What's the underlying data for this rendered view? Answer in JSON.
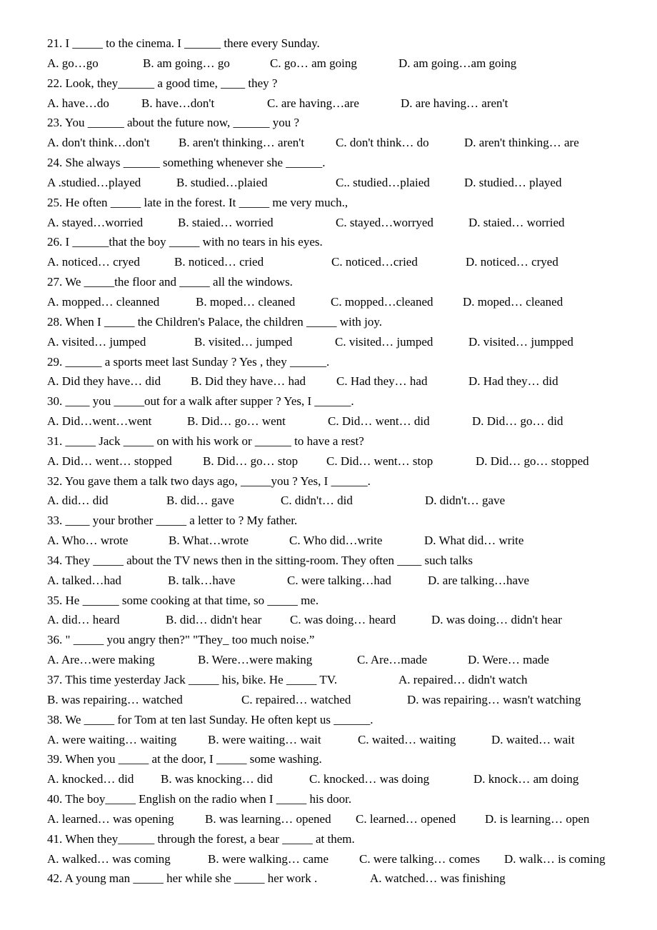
{
  "document": {
    "questions": [
      {
        "stem": "21. I _____ to the cinema. I ______ there every Sunday.",
        "options": [
          "A. go…go",
          "B. am going… go",
          "C. go… am going",
          "D. am going…am going"
        ]
      },
      {
        "stem": "22. Look, they______ a good time, ____ they ?",
        "options": [
          "A. have…do",
          "B. have…don't",
          "C. are having…are",
          "D. are having… aren't"
        ]
      },
      {
        "stem": "23. You ______ about the future now, ______ you ?",
        "options": [
          "A. don't think…don't",
          "B. aren't thinking… aren't",
          "C. don't think… do",
          "D. aren't thinking… are"
        ]
      },
      {
        "stem": "24. She always ______ something whenever she ______.",
        "options": [
          "A .studied…played",
          "B. studied…plaied",
          "C.. studied…plaied",
          "D. studied… played"
        ]
      },
      {
        "stem": "25. He often _____ late in the forest. It _____ me very much.,",
        "options": [
          "A. stayed…worried",
          "B. staied… worried",
          "C. stayed…worryed",
          "D. staied… worried"
        ]
      },
      {
        "stem": "26. I ______that the boy _____ with no tears in his eyes.",
        "options": [
          "A. noticed… cryed",
          "B. noticed… cried",
          "C. noticed…cried",
          "D. noticed… cryed"
        ]
      },
      {
        "stem": "27. We _____the floor and _____ all the windows.",
        "options": [
          "A. mopped… cleanned",
          "B. moped… cleaned",
          "C. mopped…cleaned",
          "D. moped… cleaned"
        ]
      },
      {
        "stem": "28. When I _____ the Children's Palace, the children _____ with joy.",
        "options": [
          "A. visited… jumped",
          "B. visited… jumped",
          "C. visited… jumped",
          "D. visited… jumpped"
        ]
      },
      {
        "stem": "29. ______ a sports meet last Sunday ? Yes , they ______.",
        "options": [
          "A. Did they have… did",
          "B. Did they have… had",
          "C. Had they… had",
          "D. Had they… did"
        ]
      },
      {
        "stem": "30. ____ you _____out for a walk after supper ? Yes, I ______.",
        "options": [
          "A. Did…went…went",
          "B. Did… go… went",
          "C. Did… went… did",
          "D. Did… go… did"
        ]
      },
      {
        "stem": "31. _____ Jack _____ on with his work or ______ to have a rest?",
        "options": [
          "A. Did… went… stopped",
          "B. Did… go… stop",
          "C. Did… went… stop",
          "D. Did… go… stopped"
        ]
      },
      {
        "stem": "32. You gave them a talk two days ago, _____you ? Yes, I ______.",
        "options": [
          "A. did… did",
          "B. did… gave",
          "C. didn't… did",
          "D. didn't… gave"
        ]
      },
      {
        "stem": "33. ____ your brother _____ a letter to ? My father.",
        "options": [
          "A. Who… wrote",
          "B. What…wrote",
          "C. Who did…write",
          "D. What did… write"
        ]
      },
      {
        "stem": "34. They _____ about the TV news then in the sitting-room. They often ____ such talks",
        "options": [
          "A. talked…had",
          "B. talk…have",
          "C. were talking…had",
          "D. are talking…have"
        ]
      },
      {
        "stem": "35. He ______ some cooking at that time, so _____ me.",
        "options": [
          "A. did… heard",
          "B. did… didn't hear",
          "C. was doing… heard",
          "D. was doing… didn't hear"
        ]
      },
      {
        "stem": "36. \" _____ you angry then?\" \"They_ too much noise.”",
        "options": [
          "A. Are…were making",
          "B. Were…were making",
          "C. Are…made",
          "D. Were… made"
        ]
      },
      {
        "stem": "37. This time yesterday Jack _____ his, bike. He _____ TV.",
        "inline_option": "A. repaired… didn't watch",
        "options": [
          "B. was repairing… watched",
          "C. repaired… watched",
          "D. was repairing… wasn't watching"
        ]
      },
      {
        "stem": "38. We _____ for Tom at ten last Sunday. He often kept us ______.",
        "options": [
          "A. were waiting… waiting",
          "B. were waiting… wait",
          "C. waited… waiting",
          "D. waited… wait"
        ]
      },
      {
        "stem": "39. When you _____ at the door, I _____ some washing.",
        "options": [
          "A. knocked… did",
          "B. was knocking… did",
          "C. knocked… was doing",
          "D. knock… am doing"
        ]
      },
      {
        "stem": "40. The boy_____ English on the radio when I _____ his door.",
        "options": [
          "A. learned… was opening",
          "B. was learning… opened",
          "C. learned… opened",
          "D. is learning… open"
        ]
      },
      {
        "stem": "41. When they______ through the forest, a bear _____ at them.",
        "options": [
          "A. walked… was coming",
          "B. were walking… came",
          "C. were talking… comes",
          "D. walk… is coming"
        ]
      },
      {
        "stem": "42. A young man _____ her while she _____ her work .",
        "inline_option": "A. watched… was finishing",
        "options": []
      }
    ]
  }
}
